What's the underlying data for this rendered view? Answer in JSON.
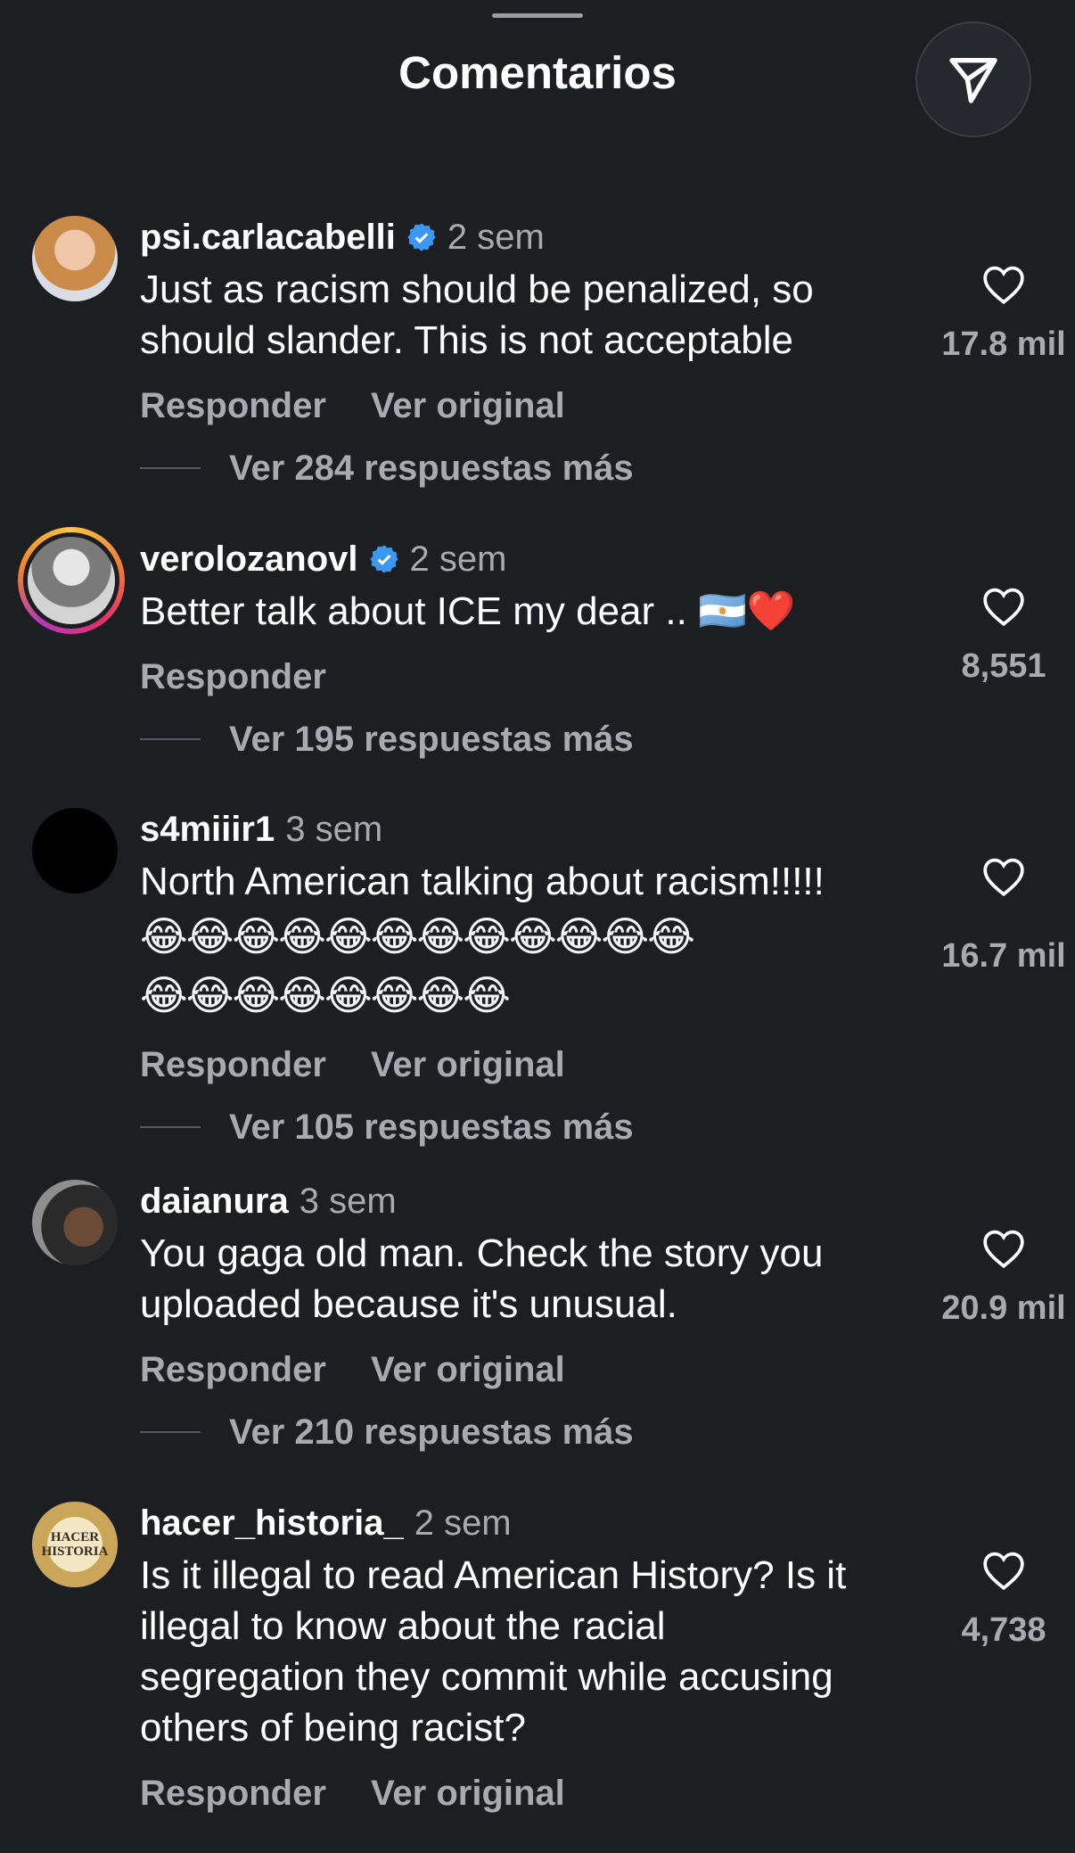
{
  "header": {
    "title": "Comentarios"
  },
  "comments": [
    {
      "username": "psi.carlacabelli",
      "verified": true,
      "time": "2 sem",
      "text": "Just as racism should be penalized, so\nshould slander. This is not acceptable",
      "likes": "17.8 mil",
      "reply_label": "Responder",
      "original_label": "Ver original",
      "replies_label": "Ver 284 respuestas más"
    },
    {
      "username": "verolozanovl",
      "verified": true,
      "time": "2 sem",
      "text": "Better talk about ICE my dear .. 🇦🇷❤️",
      "likes": "8,551",
      "reply_label": "Responder",
      "replies_label": "Ver 195 respuestas más"
    },
    {
      "username": "s4miiir1",
      "verified": false,
      "time": "3 sem",
      "text": "North American talking about racism!!!!!",
      "emoji_line1": "😂😂😂😂😂😂😂😂😂😂😂😂",
      "emoji_line2": "😂😂😂😂😂😂😂😂",
      "likes": "16.7 mil",
      "reply_label": "Responder",
      "original_label": "Ver original",
      "replies_label": "Ver 105 respuestas más"
    },
    {
      "username": "daianura",
      "verified": false,
      "time": "3 sem",
      "text": "You gaga old man. Check the story you\nuploaded because it's unusual.",
      "likes": "20.9 mil",
      "reply_label": "Responder",
      "original_label": "Ver original",
      "replies_label": "Ver 210 respuestas más"
    },
    {
      "username": "hacer_historia_",
      "verified": false,
      "time": "2 sem",
      "avatar_text": "HACER HISTORIA",
      "text": "Is it illegal to read American History? Is it\nillegal to know about the racial\nsegregation they commit while accusing\nothers of being racist?",
      "likes": "4,738",
      "reply_label": "Responder",
      "original_label": "Ver original"
    }
  ]
}
